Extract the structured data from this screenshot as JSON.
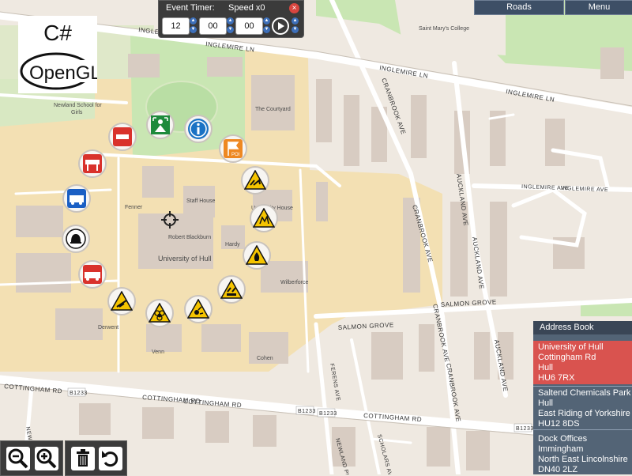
{
  "logo": {
    "language": "C#",
    "library": "OpenGL"
  },
  "timer": {
    "title": "Event Timer:",
    "speed": "Speed x0",
    "close": "×",
    "hours": "12",
    "minutes": "00",
    "seconds": "00"
  },
  "topbar": {
    "roads": "Roads",
    "menu": "Menu"
  },
  "map": {
    "places": [
      "Newland School for",
      "Girls",
      "The Courtyard",
      "Saint Mary's College",
      "Fenner",
      "Staff House",
      "University House",
      "Robert Blackburn",
      "Hardy",
      "University of Hull",
      "Wilberforce",
      "Derwent",
      "Venn",
      "Cohen"
    ],
    "roads": {
      "inglemire_1": "INGLEMIRE LN",
      "inglemire_2": "INGLEMIRE LN",
      "inglemire_3": "INGLEMIRE LN",
      "inglemire_ave": "INGLEMIRE AVE",
      "inglemire_ave2": "INGLEMIRE AVE",
      "cranbrook_1": "CRANBROOK AVE",
      "cranbrook_2": "CRANBROOK AVE",
      "cranbrook_3": "CRANBROOK AVE",
      "cranbrook_4": "CRANBROOK AVE",
      "auckland_1": "AUCKLAND AVE",
      "auckland_2": "AUCKLAND AVE",
      "auckland_3": "AUCKLAND AVE",
      "salmon_1": "SALMON GROVE",
      "salmon_2": "SALMON GROVE",
      "cottingham_1": "COTTINGHAM RD",
      "cottingham_2": "COTTINGHAM RD",
      "b1233_1": "B1233",
      "b1233_2": "B1233",
      "b1233_3": "B1233",
      "b1233_4": "B1233",
      "ferens": "FERENS AVE",
      "newland_pk": "NEWLAND PK",
      "scholars": "SCHOLARS AVE",
      "newland": "NEWLAND"
    },
    "poi_label": "POI",
    "icons": [
      "no-entry-icon",
      "assembly-point-icon",
      "information-icon",
      "poi-flag-icon",
      "roadblock-icon",
      "harmful-substance-icon",
      "ambulance-icon",
      "explosive-icon",
      "alarm-bell-icon",
      "flammable-icon",
      "fire-engine-icon",
      "corrosive-icon",
      "corrosive-icon",
      "biohazard-icon",
      "explosive-icon",
      "crosshair-icon"
    ]
  },
  "address_book": {
    "title": "Address Book",
    "entries": [
      {
        "line1": "University of Hull",
        "line2": "Cottingham Rd",
        "line3": "Hull",
        "line4": "HU6 7RX"
      },
      {
        "line1": "Saltend Chemicals Park",
        "line2": "Hull",
        "line3": "East Riding of Yorkshire",
        "line4": "HU12 8DS"
      },
      {
        "line1": "Dock Offices",
        "line2": "Immingham",
        "line3": "North East Lincolnshire",
        "line4": "DN40 2LZ"
      }
    ]
  },
  "toolbar": {
    "icons": [
      "zoom-out-icon",
      "zoom-in-icon",
      "trash-icon",
      "reset-icon"
    ]
  },
  "colors": {
    "campus": "#f3e0b3",
    "road": "#ffffff",
    "building": "#d8ccc2",
    "park": "#c9e6b3",
    "selected": "#d9534f",
    "panel": "#536476"
  }
}
